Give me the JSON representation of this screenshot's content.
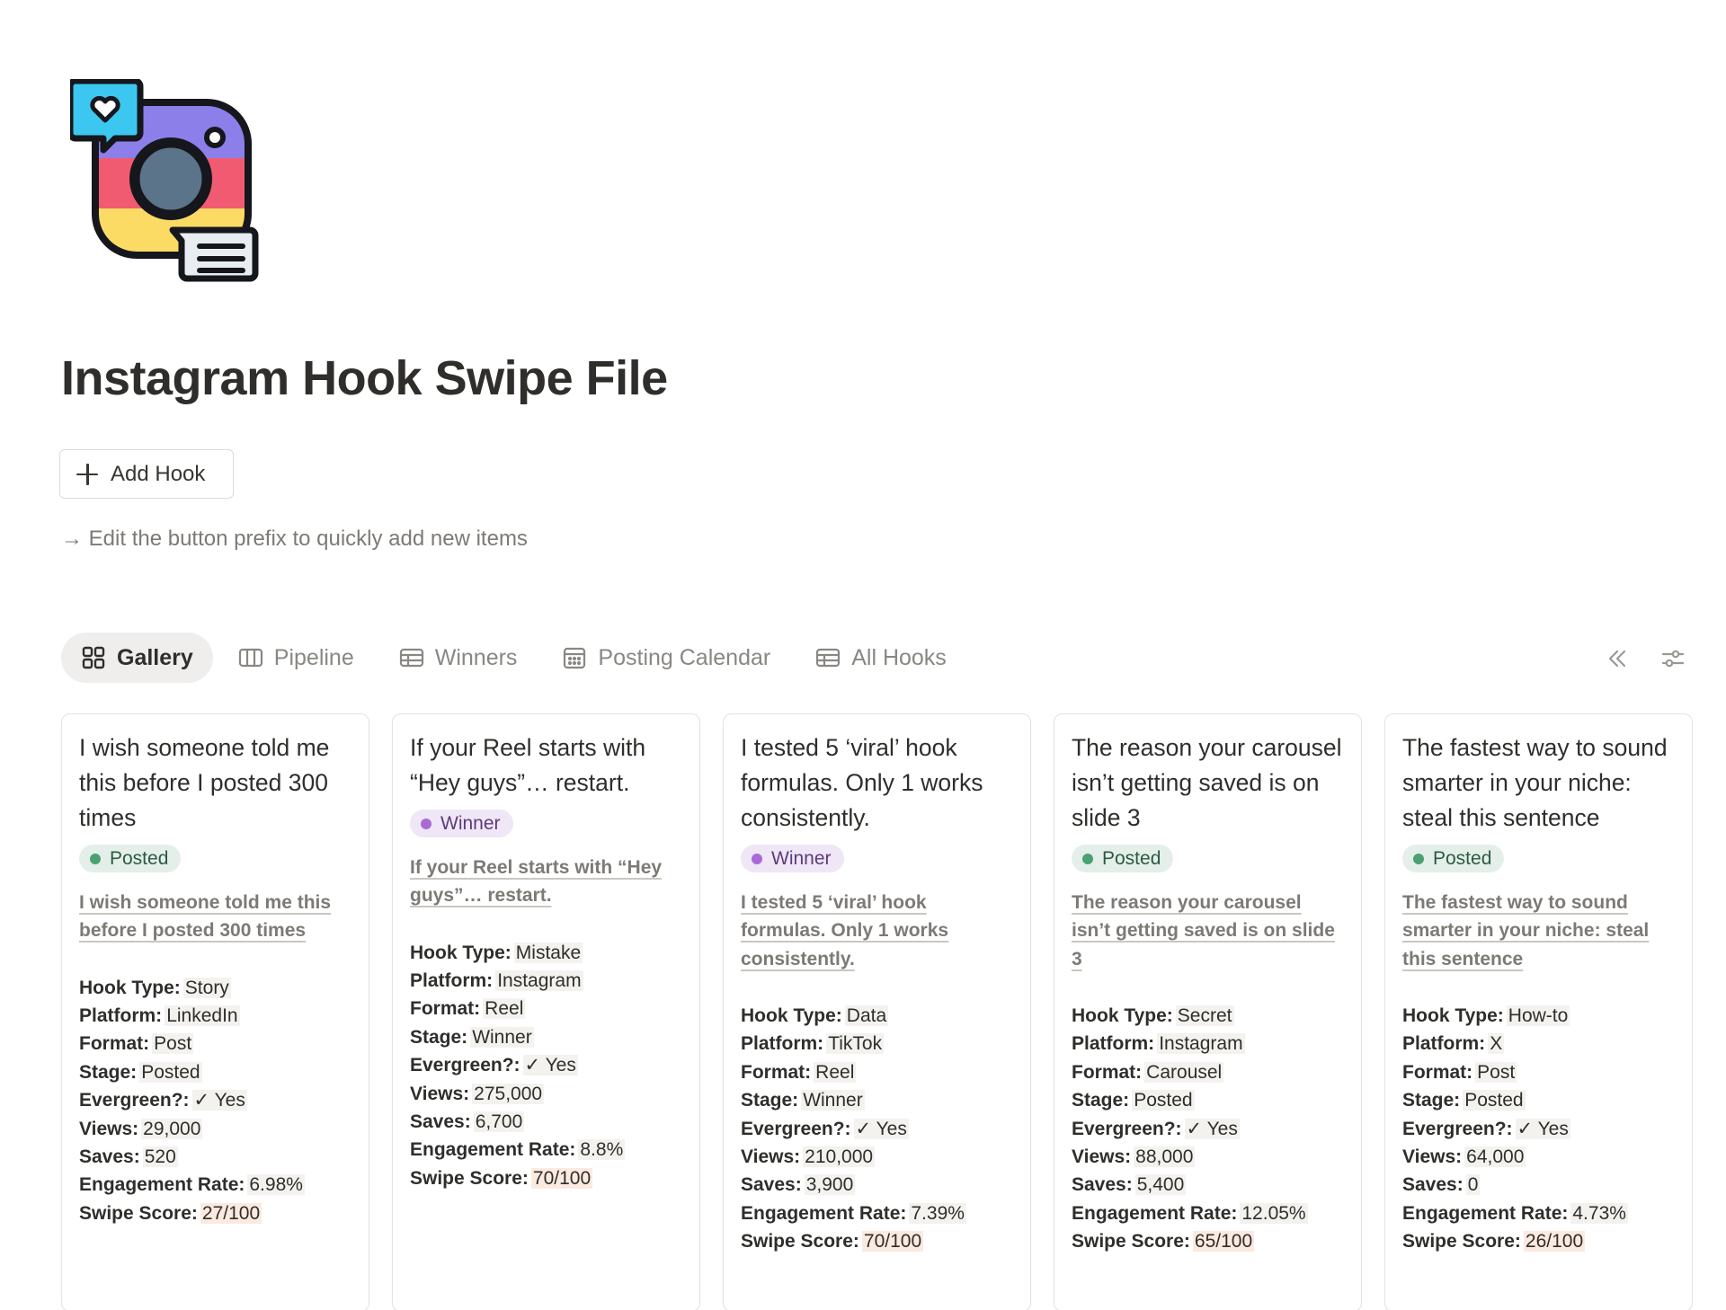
{
  "page": {
    "icon": "instagram-chat-icon",
    "title": "Instagram Hook Swipe File",
    "add_button_label": "Add Hook",
    "hint": "→ Edit the button prefix to quickly add new items"
  },
  "tabs": [
    {
      "label": "Gallery",
      "icon": "gallery-grid-icon",
      "active": true
    },
    {
      "label": "Pipeline",
      "icon": "board-columns-icon",
      "active": false
    },
    {
      "label": "Winners",
      "icon": "table-icon",
      "active": false
    },
    {
      "label": "Posting Calendar",
      "icon": "calendar-icon",
      "active": false
    },
    {
      "label": "All Hooks",
      "icon": "table-icon",
      "active": false
    }
  ],
  "toolbar": {
    "collapse_icon": "double-chevron-left-icon",
    "settings_icon": "sliders-icon"
  },
  "labels": {
    "hook_type": "Hook Type:",
    "platform": "Platform:",
    "format": "Format:",
    "stage": "Stage:",
    "evergreen": "Evergreen?:",
    "views": "Views:",
    "saves": "Saves:",
    "engagement_rate": "Engagement Rate:",
    "swipe_score": "Swipe Score:"
  },
  "status_colors": {
    "Posted": "#4aa172",
    "Winner": "#a86bd6"
  },
  "cards": [
    {
      "title": "I wish someone told me this before I posted 300 times",
      "status": "Posted",
      "hook": "I wish someone told me this before I posted 300 times",
      "hook_type": "Story",
      "platform": "LinkedIn",
      "format": "Post",
      "stage": "Posted",
      "evergreen": "✓ Yes",
      "views": "29,000",
      "saves": "520",
      "engagement_rate": "6.98%",
      "swipe_score": "27/100"
    },
    {
      "title": "If your Reel starts with “Hey guys”… restart.",
      "status": "Winner",
      "hook": "If your Reel starts with “Hey guys”… restart.",
      "hook_type": "Mistake",
      "platform": "Instagram",
      "format": "Reel",
      "stage": "Winner",
      "evergreen": "✓ Yes",
      "views": "275,000",
      "saves": "6,700",
      "engagement_rate": "8.8%",
      "swipe_score": "70/100"
    },
    {
      "title": "I tested 5 ‘viral’ hook formulas. Only 1 works consistently.",
      "status": "Winner",
      "hook": "I tested 5 ‘viral’ hook formulas. Only 1 works consistently.",
      "hook_type": "Data",
      "platform": "TikTok",
      "format": "Reel",
      "stage": "Winner",
      "evergreen": "✓ Yes",
      "views": "210,000",
      "saves": "3,900",
      "engagement_rate": "7.39%",
      "swipe_score": "70/100"
    },
    {
      "title": "The reason your carousel isn’t getting saved is on slide 3",
      "status": "Posted",
      "hook": "The reason your carousel isn’t getting saved is on slide 3",
      "hook_type": "Secret",
      "platform": "Instagram",
      "format": "Carousel",
      "stage": "Posted",
      "evergreen": "✓ Yes",
      "views": "88,000",
      "saves": "5,400",
      "engagement_rate": "12.05%",
      "swipe_score": "65/100"
    },
    {
      "title": "The fastest way to sound smarter in your niche: steal this sentence",
      "status": "Posted",
      "hook": "The fastest way to sound smarter in your niche: steal this sentence",
      "hook_type": "How-to",
      "platform": "X",
      "format": "Post",
      "stage": "Posted",
      "evergreen": "✓ Yes",
      "views": "64,000",
      "saves": "0",
      "engagement_rate": "4.73%",
      "swipe_score": "26/100"
    }
  ]
}
